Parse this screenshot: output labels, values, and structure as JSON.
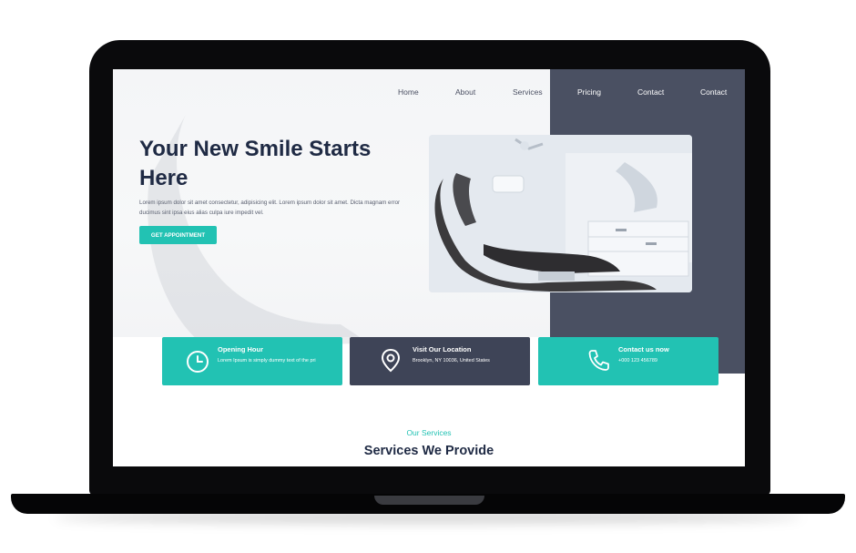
{
  "nav": {
    "items": [
      "Home",
      "About",
      "Services",
      "Pricing",
      "Contact",
      "Contact"
    ]
  },
  "hero": {
    "title": "Your New Smile Starts Here",
    "description": "Lorem ipsum dolor sit amet consectetur, adipisicing elit. Lorem ipsum dolor sit amet. Dicta magnam error ducimus sint ipsa eius alias culpa iure impedit vel.",
    "cta_label": "GET APPOINTMENT"
  },
  "cards": [
    {
      "title": "Opening Hour",
      "text": "Lorem Ipsum is simply dummy text of the pri",
      "icon": "clock-icon"
    },
    {
      "title": "Visit Our Location",
      "text": "Brooklyn, NY 10036, United States",
      "icon": "location-pin-icon"
    },
    {
      "title": "Contact us now",
      "text": "+000 123 456789",
      "icon": "phone-icon"
    }
  ],
  "services": {
    "label": "Our Services",
    "title": "Services We Provide"
  },
  "colors": {
    "accent": "#22c2b3",
    "dark_panel": "#4a5062",
    "heading": "#1f2a44"
  }
}
